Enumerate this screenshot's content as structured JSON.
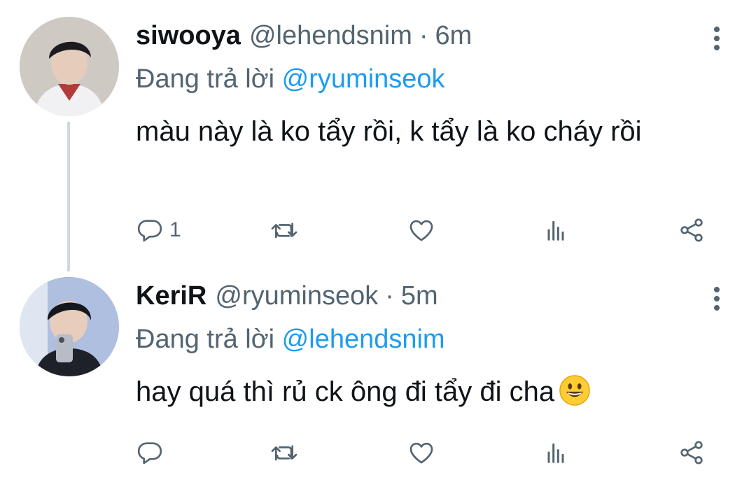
{
  "tweets": [
    {
      "name": "siwooya",
      "handle": "@lehendsnim",
      "separator": "·",
      "time": "6m",
      "reply_prefix": "Đang trả lời",
      "reply_to": "@ryuminseok",
      "text": "màu này là ko tẩy rồi, k tẩy là ko cháy rồi",
      "reply_count": "1",
      "icons": [
        "reply-icon",
        "retweet-icon",
        "like-icon",
        "views-icon",
        "share-icon"
      ]
    },
    {
      "name": "KeriR",
      "handle": "@ryuminseok",
      "separator": "·",
      "time": "5m",
      "reply_prefix": "Đang trả lời",
      "reply_to": "@lehendsnim",
      "text": "hay quá thì rủ ck ông đi tẩy đi cha",
      "emoji": "grinning-face-emoji",
      "reply_count": "",
      "icons": [
        "reply-icon",
        "retweet-icon",
        "like-icon",
        "views-icon",
        "share-icon"
      ]
    }
  ],
  "colors": {
    "text": "#0f1419",
    "muted": "#536471",
    "link": "#1d9bf0",
    "thread_line": "#cfd9de",
    "background": "#ffffff"
  }
}
